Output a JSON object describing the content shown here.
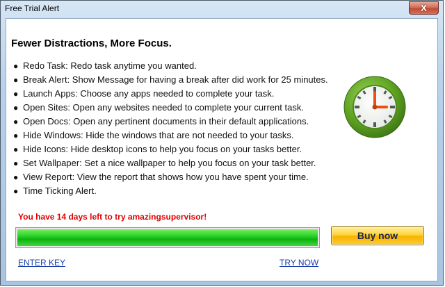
{
  "window": {
    "title": "Free Trial Alert",
    "close_label": "X"
  },
  "headline": "Fewer Distractions, More Focus.",
  "features": [
    "Redo Task: Redo task anytime you wanted.",
    "Break Alert: Show Message for having a break after did work for 25 minutes.",
    "Launch Apps: Choose any apps needed to complete your task.",
    "Open Sites: Open any websites needed to complete your current task.",
    "Open Docs: Open any pertinent documents in their default applications.",
    "Hide Windows: Hide the windows that are not needed to your tasks.",
    "Hide Icons: Hide desktop icons to help you focus on your tasks better.",
    "Set Wallpaper: Set a nice wallpaper to help you focus on your task better.",
    "View Report: View the report that shows how you have spent your time.",
    "Time Ticking Alert."
  ],
  "bullet_char": "●",
  "trial": {
    "message": "You have 14 days left to try amazingsupervisor!",
    "progress": 1.0
  },
  "buttons": {
    "buy": "Buy now"
  },
  "links": {
    "enter_key": "ENTER KEY",
    "try_now": "TRY NOW"
  },
  "icons": {
    "clock": "clock-icon",
    "close": "close-icon"
  },
  "colors": {
    "accent_green": "#5fa323",
    "trial_text": "#e00000",
    "buy_button": "#ffd43b",
    "link": "#1b3ea8"
  }
}
